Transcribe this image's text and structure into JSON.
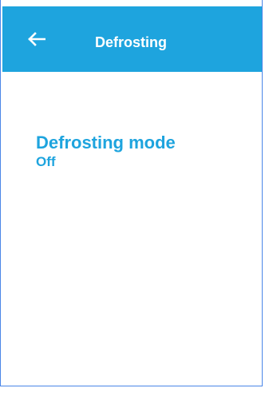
{
  "app_bar": {
    "title": "Defrosting",
    "back_icon": "arrow-left-icon",
    "background_color": "#1ea4de",
    "text_color": "#ffffff"
  },
  "settings": {
    "defrosting_mode": {
      "label": "Defrosting mode",
      "value": "Off",
      "color": "#1ea4de"
    }
  }
}
